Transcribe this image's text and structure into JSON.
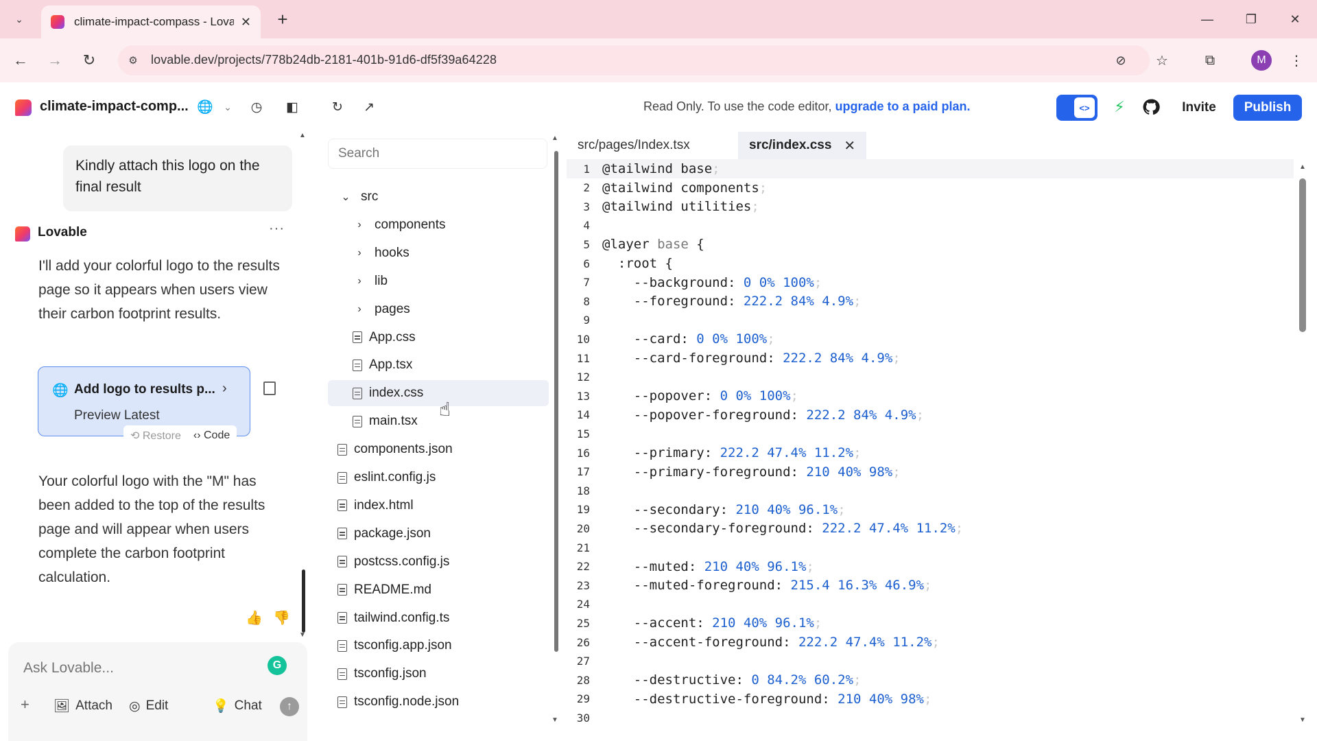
{
  "browser": {
    "tab_title": "climate-impact-compass - Lova",
    "url": "lovable.dev/projects/778b24db-2181-401b-91d6-df5f39a64228",
    "avatar_letter": "M"
  },
  "header": {
    "project_name": "climate-impact-comp...",
    "readonly_text": "Read Only. To use the code editor, ",
    "upgrade_link": "upgrade to a paid plan.",
    "invite_label": "Invite",
    "publish_label": "Publish",
    "code_toggle_label": "<>"
  },
  "chat": {
    "user_message": "Kindly attach this logo on the final result",
    "assistant_name": "Lovable",
    "assistant_message_1": "I'll add your colorful logo to the results page so it appears when users view their carbon footprint results.",
    "card_title": "Add logo to results p...",
    "card_subtitle": "Preview Latest",
    "restore_label": "Restore",
    "code_label": "Code",
    "assistant_message_2": "Your colorful logo with the \"M\" has been added to the top of the results page and will appear when users complete the carbon footprint calculation.",
    "composer_placeholder": "Ask Lovable...",
    "attach_label": "Attach",
    "edit_label": "Edit",
    "chat_label": "Chat"
  },
  "filetree": {
    "search_placeholder": "Search",
    "items": [
      {
        "label": "src",
        "kind": "folder-open"
      },
      {
        "label": "components",
        "kind": "folder"
      },
      {
        "label": "hooks",
        "kind": "folder"
      },
      {
        "label": "lib",
        "kind": "folder"
      },
      {
        "label": "pages",
        "kind": "folder"
      },
      {
        "label": "App.css",
        "kind": "file"
      },
      {
        "label": "App.tsx",
        "kind": "file"
      },
      {
        "label": "index.css",
        "kind": "file",
        "selected": true
      },
      {
        "label": "main.tsx",
        "kind": "file"
      },
      {
        "label": "components.json",
        "kind": "file"
      },
      {
        "label": "eslint.config.js",
        "kind": "file"
      },
      {
        "label": "index.html",
        "kind": "file"
      },
      {
        "label": "package.json",
        "kind": "file"
      },
      {
        "label": "postcss.config.js",
        "kind": "file"
      },
      {
        "label": "README.md",
        "kind": "file"
      },
      {
        "label": "tailwind.config.ts",
        "kind": "file"
      },
      {
        "label": "tsconfig.app.json",
        "kind": "file"
      },
      {
        "label": "tsconfig.json",
        "kind": "file"
      },
      {
        "label": "tsconfig.node.json",
        "kind": "file"
      }
    ]
  },
  "editor": {
    "tabs": [
      {
        "label": "src/pages/Index.tsx",
        "active": false
      },
      {
        "label": "src/index.css",
        "active": true
      }
    ],
    "lines": [
      "@tailwind base;",
      "@tailwind components;",
      "@tailwind utilities;",
      "",
      "@layer base {",
      "  :root {",
      "    --background: 0 0% 100%;",
      "    --foreground: 222.2 84% 4.9%;",
      "",
      "    --card: 0 0% 100%;",
      "    --card-foreground: 222.2 84% 4.9%;",
      "",
      "    --popover: 0 0% 100%;",
      "    --popover-foreground: 222.2 84% 4.9%;",
      "",
      "    --primary: 222.2 47.4% 11.2%;",
      "    --primary-foreground: 210 40% 98%;",
      "",
      "    --secondary: 210 40% 96.1%;",
      "    --secondary-foreground: 222.2 47.4% 11.2%;",
      "",
      "    --muted: 210 40% 96.1%;",
      "    --muted-foreground: 215.4 16.3% 46.9%;",
      "",
      "    --accent: 210 40% 96.1%;",
      "    --accent-foreground: 222.2 47.4% 11.2%;",
      "",
      "    --destructive: 0 84.2% 60.2%;",
      "    --destructive-foreground: 210 40% 98%;",
      ""
    ]
  },
  "colors": {
    "accent_blue": "#2563eb",
    "tab_strip_pink": "#f8d7de",
    "grammarly_green": "#15c39a",
    "bolt_green": "#22c55e"
  }
}
